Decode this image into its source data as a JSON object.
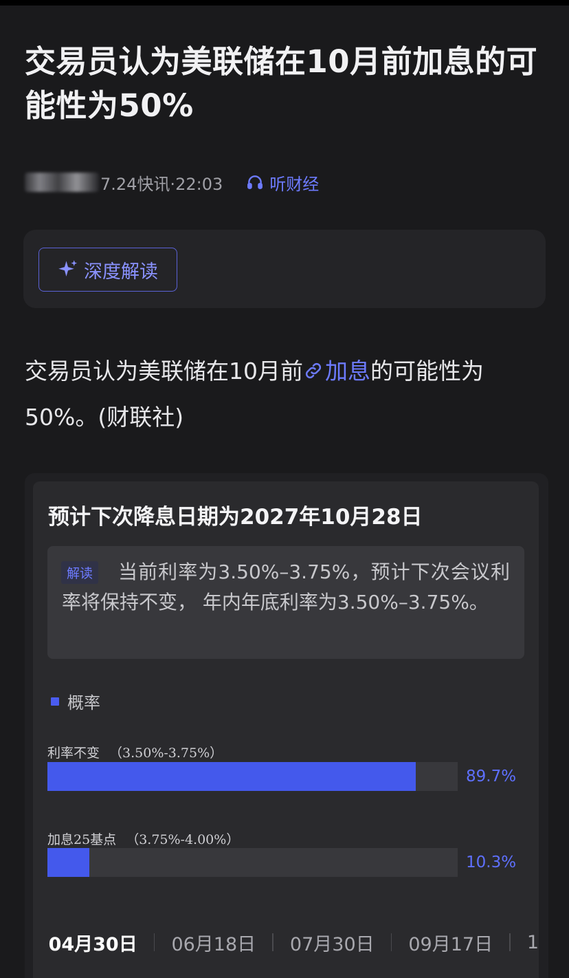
{
  "article": {
    "title": "交易员认为美联储在10月前加息的可能性为50%",
    "meta_source": "7.24快讯·22:03",
    "listen_label": "听财经",
    "ai_button_label": "深度解读",
    "body_before_link": "交易员认为美联储在10月前",
    "body_link": "加息",
    "body_after_link": "的可能性为50%。(财联社)"
  },
  "widget": {
    "title": "预计下次降息日期为2027年10月28日",
    "interpretation_tag": "解读",
    "interpretation_text": "当前利率为3.50%–3.75%，预计下次会议利率将保持不变， 年内年底利率为3.50%–3.75%。",
    "legend_label": "概率",
    "accent_color": "#4459ec",
    "bars": [
      {
        "label": "利率不变",
        "range": "（3.50%-3.75%）",
        "percent_text": "89.7%",
        "value": 89.7
      },
      {
        "label": "加息25基点",
        "range": "（3.75%-4.00%）",
        "percent_text": "10.3%",
        "value": 10.3
      }
    ],
    "dates": [
      "04月30日",
      "06月18日",
      "07月30日",
      "09月17日",
      "1"
    ],
    "active_date": "04月30日"
  }
}
